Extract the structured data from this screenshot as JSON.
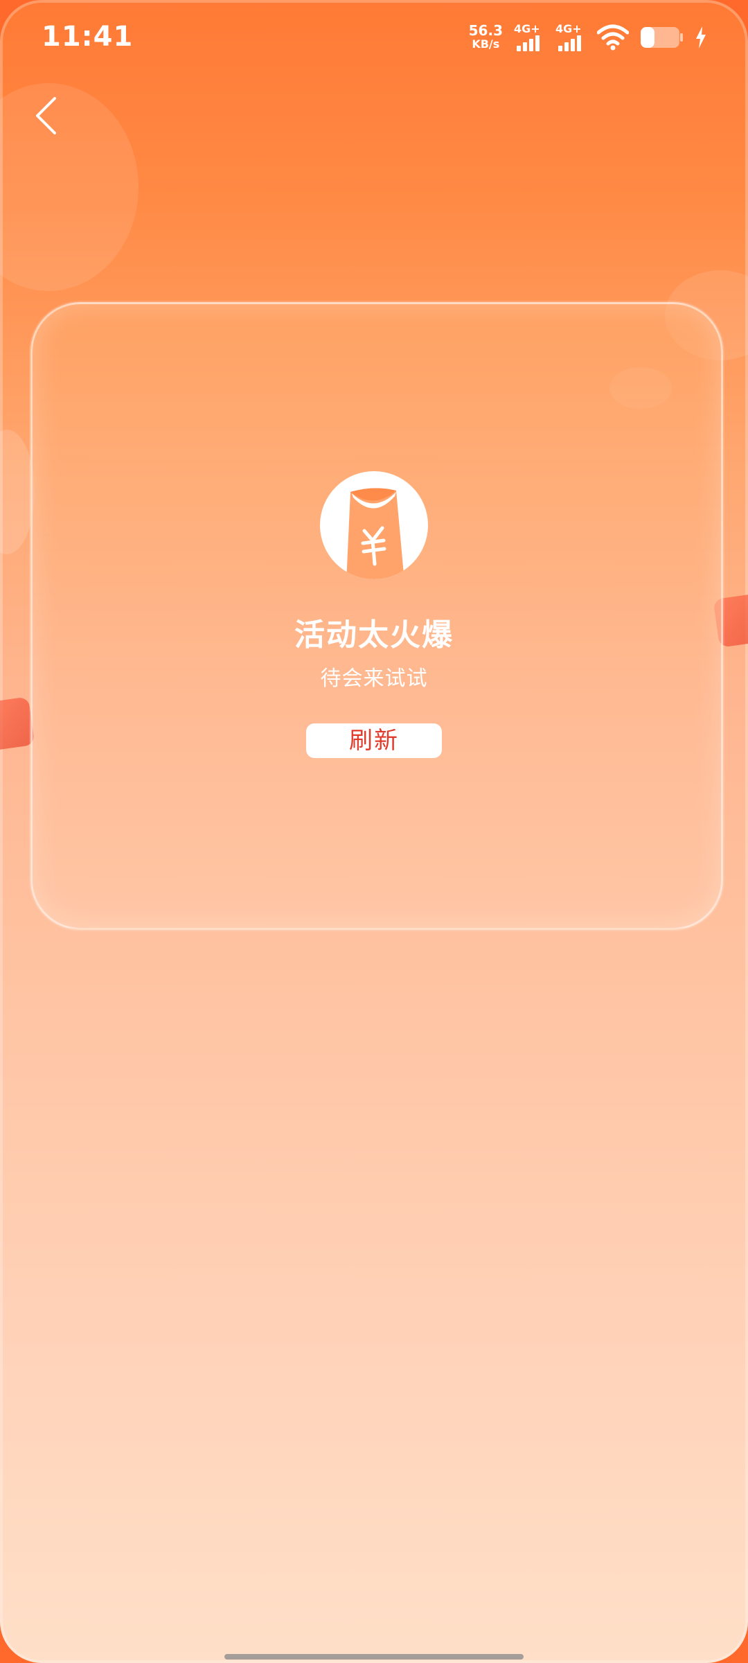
{
  "status_bar": {
    "time": "11:41",
    "net_speed_value": "56.3",
    "net_speed_unit": "KB/s",
    "signal_1_label": "4G+",
    "signal_2_label": "4G+",
    "icons": [
      "wifi-icon",
      "battery-icon",
      "charging-icon"
    ]
  },
  "nav": {
    "back_icon": "chevron-left-icon"
  },
  "error_card": {
    "icon": "red-envelope-yuan-icon",
    "title": "活动太火爆",
    "subtitle": "待会来试试",
    "refresh_label": "刷新"
  },
  "colors": {
    "accent": "#ff7a35",
    "button_text": "#e23a2a",
    "text_on_accent": "#ffffff"
  }
}
